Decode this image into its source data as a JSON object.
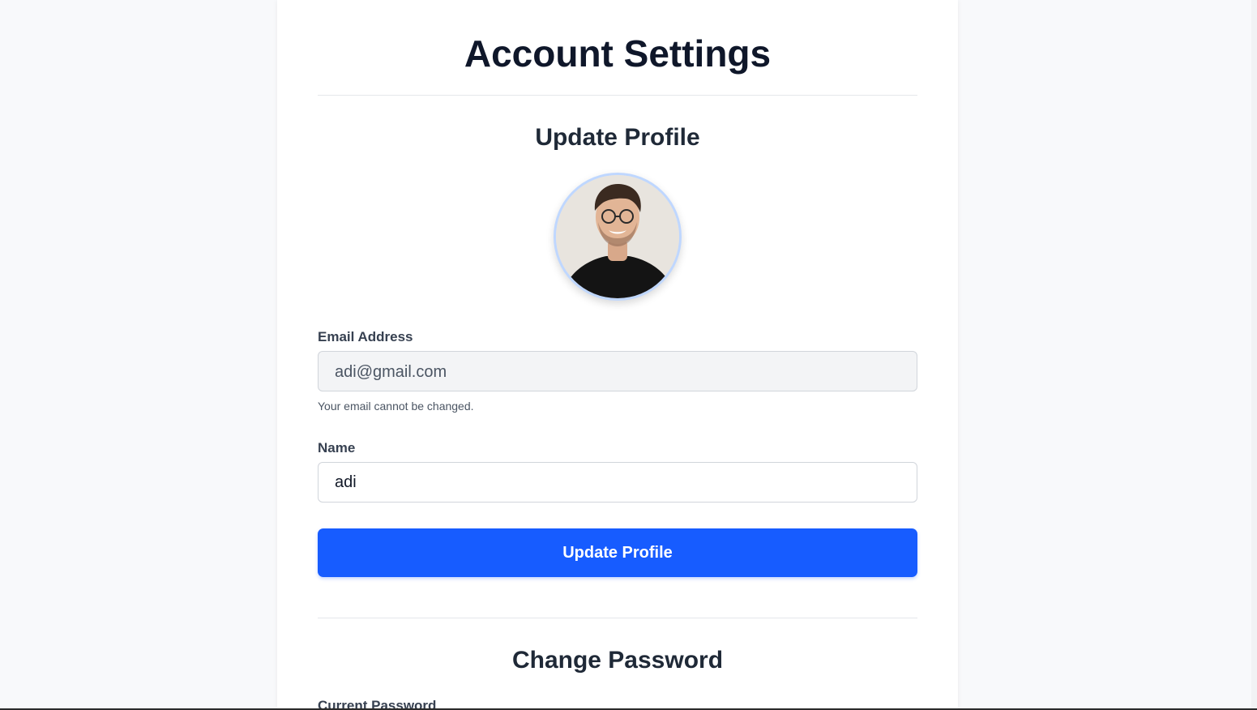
{
  "page": {
    "title": "Account Settings"
  },
  "profile": {
    "section_title": "Update Profile",
    "avatar_alt": "avatar",
    "email_label": "Email Address",
    "email_value": "adi@gmail.com",
    "email_hint": "Your email cannot be changed.",
    "name_label": "Name",
    "name_value": "adi",
    "submit_label": "Update Profile"
  },
  "password": {
    "section_title": "Change Password",
    "current_label": "Current Password"
  },
  "colors": {
    "primary": "#175cff",
    "background": "#f8f9fb",
    "card": "#ffffff",
    "avatar_ring": "#bfd7ff"
  }
}
